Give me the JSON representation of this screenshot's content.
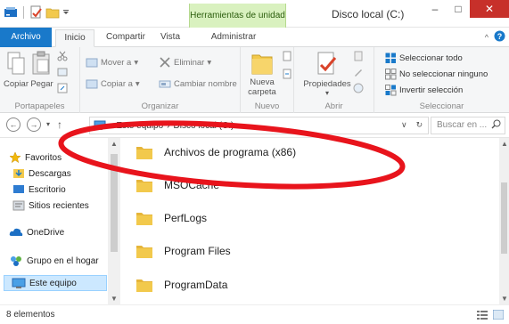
{
  "titlebar": {
    "context_tab": "Herramientas de unidad",
    "title": "Disco local (C:)",
    "minimize": "–",
    "maximize": "□",
    "close": "✕"
  },
  "tabs": {
    "file": "Archivo",
    "home": "Inicio",
    "share": "Compartir",
    "view": "Vista",
    "manage": "Administrar"
  },
  "ribbon": {
    "portapapeles": {
      "label": "Portapapeles",
      "copy": "Copiar",
      "paste": "Pegar"
    },
    "organizar": {
      "label": "Organizar",
      "move_to": "Mover a",
      "copy_to": "Copiar a",
      "delete": "Eliminar",
      "rename": "Cambiar nombre"
    },
    "nuevo": {
      "label": "Nuevo",
      "new_folder": "Nueva carpeta"
    },
    "abrir": {
      "label": "Abrir",
      "properties": "Propiedades"
    },
    "seleccionar": {
      "label": "Seleccionar",
      "select_all": "Seleccionar todo",
      "select_none": "No seleccionar ninguno",
      "invert": "Invertir selección"
    }
  },
  "address": {
    "path_computer": "Este equipo",
    "path_drive": "Disco local (C:)",
    "search_placeholder": "Buscar en ..."
  },
  "navpane": {
    "favorites": "Favoritos",
    "downloads": "Descargas",
    "desktop": "Escritorio",
    "recent": "Sitios recientes",
    "onedrive": "OneDrive",
    "homegroup": "Grupo en el hogar",
    "this_pc": "Este equipo"
  },
  "files": [
    {
      "name": "Archivos de programa (x86)"
    },
    {
      "name": "MSOCache"
    },
    {
      "name": "PerfLogs"
    },
    {
      "name": "Program Files"
    },
    {
      "name": "ProgramData"
    }
  ],
  "status": {
    "count": "8 elementos"
  },
  "colors": {
    "file_tab": "#1979ca",
    "close": "#c7302a",
    "context_tab": "#d9f1bf",
    "folder": "#f2c94c",
    "annotation": "#e8141c"
  }
}
